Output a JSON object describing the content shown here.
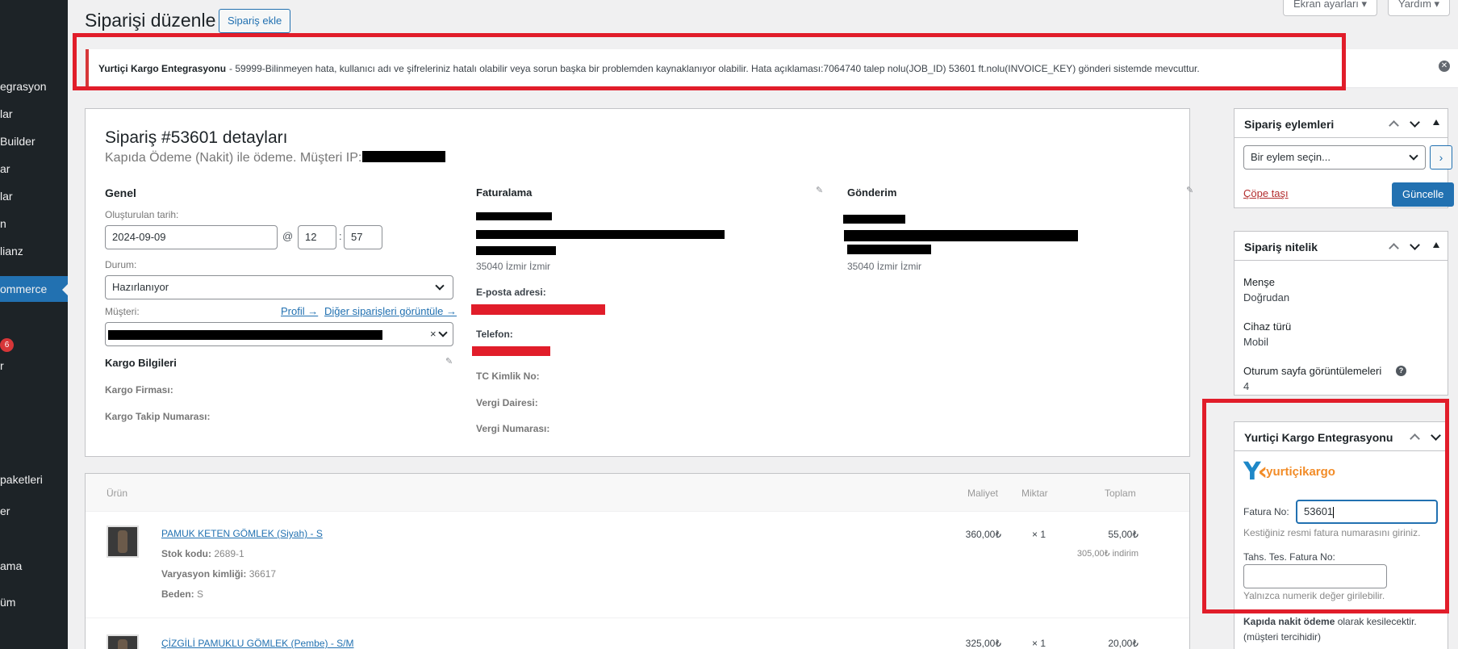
{
  "sidebar": {
    "items": [
      {
        "label": "egrasyon"
      },
      {
        "label": "lar"
      },
      {
        "label": "Builder"
      },
      {
        "label": "ar"
      },
      {
        "label": "lar"
      },
      {
        "label": "n"
      },
      {
        "label": "lianz"
      },
      {
        "label": "ommerce"
      },
      {
        "label": "6"
      },
      {
        "label": "r"
      },
      {
        "label": "paketleri"
      },
      {
        "label": "er"
      },
      {
        "label": "ama"
      },
      {
        "label": "üm"
      }
    ]
  },
  "header": {
    "title": "Siparişi düzenle",
    "add_order": "Sipariş ekle",
    "screen_options": "Ekran ayarları ▾",
    "help": "Yardım ▾"
  },
  "notice": {
    "source": "Yurtiçi Kargo Entegrasyonu",
    "message": "- 59999-Bilinmeyen hata, kullanıcı adı ve şifreleriniz hatalı olabilir veya sorun başka bir problemden kaynaklanıyor olabilir. Hata açıklaması:7064740 talep nolu(JOB_ID) 53601 ft.nolu(INVOICE_KEY) gönderi sistemde mevcuttur.",
    "dismiss": "✕"
  },
  "order": {
    "heading": "Sipariş #53601 detayları",
    "subheading": "Kapıda Ödeme (Nakit) ile ödeme. Müşteri IP:",
    "general": {
      "title": "Genel",
      "created_label": "Oluşturulan tarih:",
      "date": "2024-09-09",
      "at": "@",
      "hour": "12",
      "colon": ":",
      "minute": "57",
      "status_label": "Durum:",
      "status_value": "Hazırlanıyor",
      "customer_label": "Müşteri:",
      "profile_link": "Profil →",
      "other_orders_link": "Diğer siparişleri görüntüle →",
      "clear": "×"
    },
    "cargo": {
      "title": "Kargo Bilgileri",
      "company_label": "Kargo Firması:",
      "tracking_label": "Kargo Takip Numarası:"
    },
    "billing": {
      "title": "Faturalama",
      "city": "35040 İzmir İzmir",
      "email_label": "E-posta adresi:",
      "phone_label": "Telefon:",
      "tc_label": "TC Kimlik No:",
      "tax_office_label": "Vergi Dairesi:",
      "tax_number_label": "Vergi Numarası:"
    },
    "shipping": {
      "title": "Gönderim",
      "city": "35040 İzmir İzmir"
    }
  },
  "items": {
    "headers": {
      "product": "Ürün",
      "cost": "Maliyet",
      "qty": "Miktar",
      "total": "Toplam"
    },
    "rows": [
      {
        "name": "PAMUK KETEN GÖMLEK (Siyah) - S",
        "sku_label": "Stok kodu:",
        "sku": "2689-1",
        "variation_label": "Varyasyon kimliği:",
        "variation": "36617",
        "size_label": "Beden:",
        "size": "S",
        "cost": "360,00₺",
        "qty": "× 1",
        "total": "55,00₺",
        "discount": "305,00₺ indirim"
      },
      {
        "name": "ÇİZGİLİ PAMUKLU GÖMLEK (Pembe) - S/M",
        "cost": "325,00₺",
        "qty": "× 1",
        "total": "20,00₺"
      }
    ]
  },
  "actions_box": {
    "title": "Sipariş eylemleri",
    "select": "Bir eylem seçin...",
    "go": "›",
    "trash": "Çöpe taşı",
    "update": "Güncelle"
  },
  "attribution_box": {
    "title": "Sipariş nitelik",
    "origin_label": "Menşe",
    "origin_value": "Doğrudan",
    "device_label": "Cihaz türü",
    "device_value": "Mobil",
    "pageviews_label": "Oturum sayfa görüntülemeleri",
    "pageviews_value": "4",
    "help": "?"
  },
  "yurtici_box": {
    "title": "Yurtiçi Kargo Entegrasyonu",
    "logo_word_a": "yurtiçi",
    "logo_word_b": "kargo",
    "invoice_label": "Fatura No:",
    "invoice_value": "53601",
    "invoice_desc": "Kestiğiniz resmi fatura numarasını giriniz.",
    "collection_label": "Tahs. Tes. Fatura No:",
    "collection_value": "",
    "collection_desc": "Yalnızca numerik değer girilebilir.",
    "payment_bold": "Kapıda nakit ödeme",
    "payment_rest": "olarak kesilecektir.",
    "payment_note": "(müşteri tercihidir)"
  },
  "colors": {
    "accent": "#2271b1",
    "error": "#d63638",
    "highlight_box": "#e11d2a",
    "sidebar": "#1d2327"
  }
}
